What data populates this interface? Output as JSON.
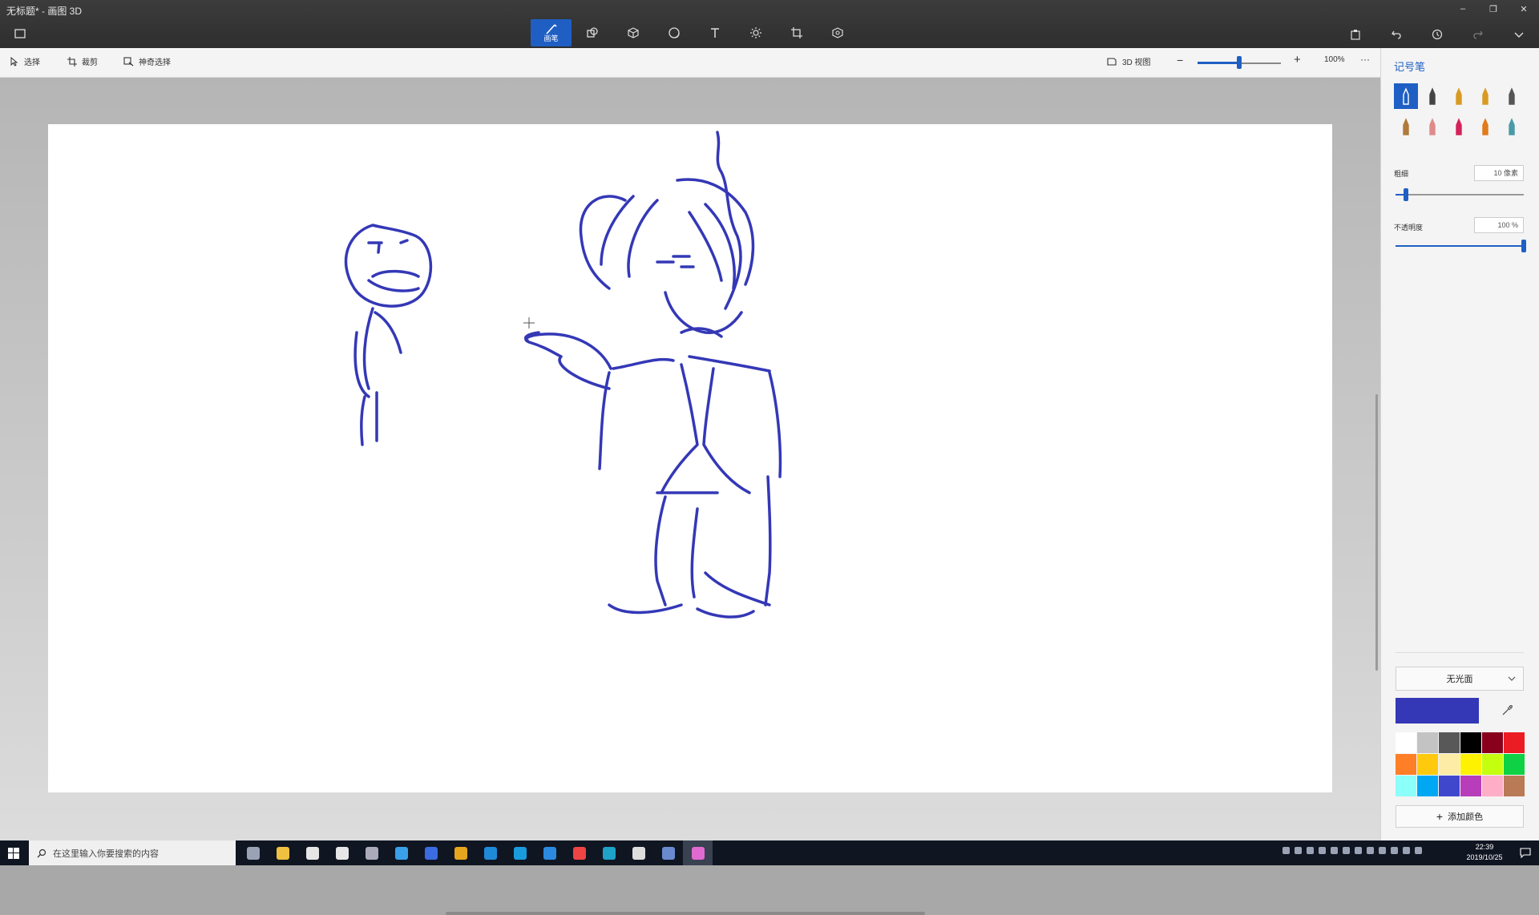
{
  "window": {
    "title": "无标题* - 画图 3D",
    "controls": [
      "–",
      "❐",
      "✕"
    ]
  },
  "top_tools": [
    {
      "icon": "brush-icon",
      "label": "画笔",
      "active": true
    },
    {
      "icon": "2d-shapes-icon",
      "label": ""
    },
    {
      "icon": "3d-shapes-icon",
      "label": ""
    },
    {
      "icon": "stickers-icon",
      "label": ""
    },
    {
      "icon": "text-icon",
      "label": ""
    },
    {
      "icon": "effects-icon",
      "label": ""
    },
    {
      "icon": "canvas-icon",
      "label": ""
    },
    {
      "icon": "3d-library-icon",
      "label": ""
    }
  ],
  "right_actions": [
    "paste-icon",
    "undo-icon",
    "history-icon",
    "redo-icon",
    "chevron-down-icon"
  ],
  "toolbar": {
    "select": "选择",
    "crop": "裁剪",
    "magic_select": "神奇选择",
    "view_3d": "3D 视图",
    "zoom_percent": 100,
    "zoom_text": "100%",
    "more": "···"
  },
  "sidebar": {
    "title": "记号笔",
    "brushes": [
      {
        "name": "marker",
        "color": "#2b55c8",
        "selected": true
      },
      {
        "name": "calligraphy-pen",
        "color": "#444"
      },
      {
        "name": "oil-brush",
        "color": "#d99a22"
      },
      {
        "name": "watercolor",
        "color": "#d99a22"
      },
      {
        "name": "pixel-pen",
        "color": "#555"
      },
      {
        "name": "pencil",
        "color": "#b07a3a"
      },
      {
        "name": "eraser",
        "color": "#e08a8a"
      },
      {
        "name": "crayon",
        "color": "#d4235a"
      },
      {
        "name": "spray-can",
        "color": "#e07a1a"
      },
      {
        "name": "fill",
        "color": "#4a9aa8"
      }
    ],
    "thickness": {
      "label": "粗细",
      "value_text": "10 像素",
      "fraction": 0.08
    },
    "opacity": {
      "label": "不透明度",
      "value_text": "100 %",
      "fraction": 1.0
    },
    "finish": "无光面",
    "current_color": "#3438b6",
    "palette": [
      "#ffffff",
      "#c3c3c3",
      "#585858",
      "#000000",
      "#88001b",
      "#ec1c24",
      "#ff7f27",
      "#ffc90e",
      "#fdeca6",
      "#fff200",
      "#c4ff0e",
      "#0ed145",
      "#8cfffb",
      "#00a8f3",
      "#3f48cc",
      "#b83dba",
      "#ffaec8",
      "#b97a56"
    ],
    "add_color": "添加颜色"
  },
  "taskbar": {
    "search_placeholder": "在这里输入你要搜索的内容",
    "apps": [
      {
        "icon": "task-view-icon",
        "color": "#9aa3b5"
      },
      {
        "icon": "file-explorer-icon",
        "color": "#f0c040"
      },
      {
        "icon": "store-icon",
        "color": "#e6e6e6"
      },
      {
        "icon": "mail-icon",
        "color": "#e6e6e6"
      },
      {
        "icon": "app-icon",
        "color": "#aab"
      },
      {
        "icon": "app-icon",
        "color": "#3aa0e8"
      },
      {
        "icon": "app-icon",
        "color": "#3b6be0"
      },
      {
        "icon": "chrome-icon",
        "color": "#e5a51d"
      },
      {
        "icon": "edge-icon",
        "color": "#1f8ad8"
      },
      {
        "icon": "app-icon",
        "color": "#1a9bdc"
      },
      {
        "icon": "edge-icon",
        "color": "#2b8ae0"
      },
      {
        "icon": "chrome-icon",
        "color": "#e44"
      },
      {
        "icon": "app-icon",
        "color": "#1ea2c8"
      },
      {
        "icon": "unity-icon",
        "color": "#ddd"
      },
      {
        "icon": "app-icon",
        "color": "#6a8ad0"
      },
      {
        "icon": "paint3d-icon",
        "color": "#e06ad0",
        "active": true
      }
    ],
    "time": "22:39",
    "date": "2019/10/25"
  }
}
